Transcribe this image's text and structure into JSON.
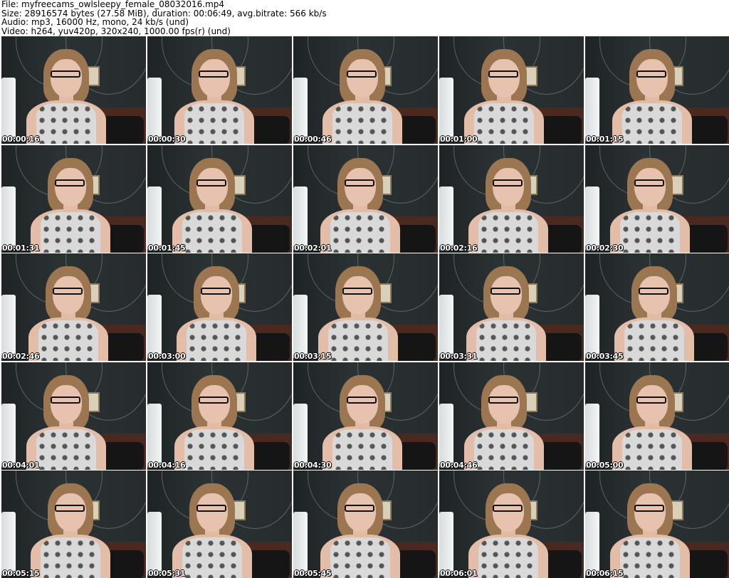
{
  "header": {
    "file": "File: myfreecams_owlsleepy_female_08032016.mp4",
    "size": "Size: 28916574 bytes (27.58 MiB), duration: 00:06:49, avg.bitrate: 566 kb/s",
    "audio": "Audio: mp3, 16000 Hz, mono, 24 kb/s (und)",
    "video": "Video: h264, yuv420p, 320x240, 1000.00 fps(r) (und)"
  },
  "thumbnails": [
    "00:00:16",
    "00:00:30",
    "00:00:46",
    "00:01:00",
    "00:01:15",
    "00:01:31",
    "00:01:45",
    "00:02:01",
    "00:02:16",
    "00:02:30",
    "00:02:46",
    "00:03:00",
    "00:03:15",
    "00:03:31",
    "00:03:45",
    "00:04:01",
    "00:04:16",
    "00:04:30",
    "00:04:46",
    "00:05:00",
    "00:05:15",
    "00:05:31",
    "00:05:45",
    "00:06:01",
    "00:06:15"
  ]
}
